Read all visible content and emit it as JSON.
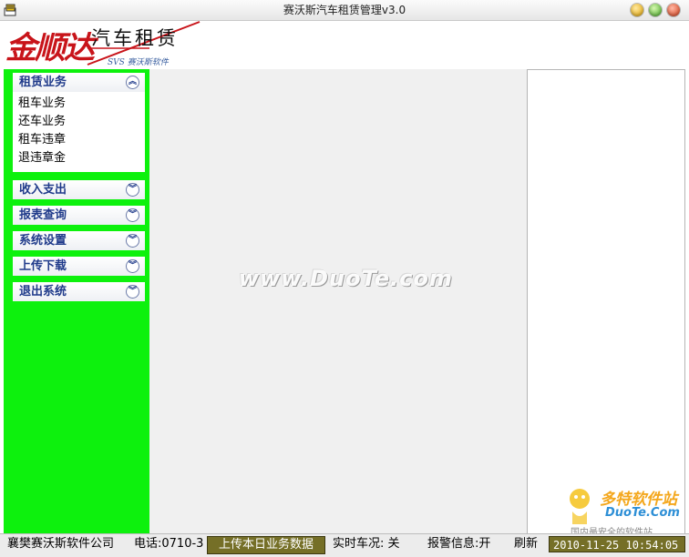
{
  "window": {
    "title": "赛沃斯汽车租赁管理v3.0"
  },
  "header": {
    "logo_text": "金顺达",
    "logo_subtitle": "汽车租赁",
    "logo_tagline": "SVS 赛沃斯软件"
  },
  "sidebar": {
    "panels": [
      {
        "label": "租赁业务",
        "expanded": true,
        "items": [
          "租车业务",
          "还车业务",
          "租车违章",
          "退违章金"
        ]
      },
      {
        "label": "收入支出",
        "expanded": false,
        "items": []
      },
      {
        "label": "报表查询",
        "expanded": false,
        "items": []
      },
      {
        "label": "系统设置",
        "expanded": false,
        "items": []
      },
      {
        "label": "上传下载",
        "expanded": false,
        "items": []
      },
      {
        "label": "退出系统",
        "expanded": false,
        "items": []
      }
    ]
  },
  "content": {
    "watermark": "www.DuoTe.com"
  },
  "statusbar": {
    "company": "襄樊赛沃斯软件公司",
    "phone": "电话:0710-3",
    "upload_button": "上传本日业务数据",
    "realtime_status": "实时车况: 关",
    "alarm_info": "报警信息:开",
    "refresh": "刷新",
    "datetime": "2010-11-25 10:54:05"
  },
  "overlay_brand": {
    "name": "多特软件站",
    "site": "DuoTe.Com",
    "tagline": "国内最安全的软件站"
  },
  "colors": {
    "sidebar_bg": "#0df10d",
    "panel_head_text": "#1f3a8a",
    "status_highlight": "#756f27"
  }
}
